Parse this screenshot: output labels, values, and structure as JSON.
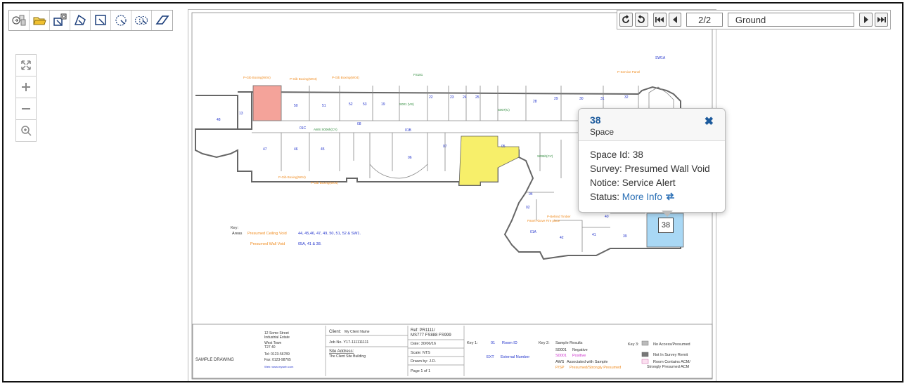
{
  "toolbar": {
    "tools": [
      {
        "name": "layers-icon"
      },
      {
        "name": "open-folder-icon"
      },
      {
        "name": "select-refresh-icon"
      },
      {
        "name": "polygon-select-icon"
      },
      {
        "name": "rectangle-select-icon"
      },
      {
        "name": "circle-select-icon"
      },
      {
        "name": "multi-circle-select-icon"
      },
      {
        "name": "eraser-icon"
      }
    ]
  },
  "zoom": {
    "items": [
      {
        "name": "fit-extent-icon"
      },
      {
        "name": "zoom-in-icon"
      },
      {
        "name": "zoom-out-icon"
      },
      {
        "name": "zoom-magnifier-icon"
      }
    ]
  },
  "nav": {
    "page": "2/2",
    "floor": "Ground"
  },
  "popup": {
    "title": "38",
    "subtitle": "Space",
    "close": "✖",
    "space_id_label": "Space Id:",
    "space_id": "38",
    "survey_label": "Survey:",
    "survey": "Presumed Wall Void",
    "notice_label": "Notice:",
    "notice": "Service Alert",
    "status_label": "Status:",
    "status_link": "More Info"
  },
  "marker": "38",
  "plan": {
    "rooms": [
      "48",
      "13",
      "50",
      "51",
      "52",
      "53",
      "19",
      "15",
      "20",
      "21",
      "22",
      "23",
      "24",
      "25",
      "26",
      "27",
      "28",
      "29",
      "30",
      "31",
      "32",
      "33",
      "34",
      "35",
      "36",
      "37",
      "38",
      "39",
      "40",
      "41",
      "42",
      "43",
      "44",
      "45",
      "46",
      "47",
      "01A",
      "01B",
      "01C",
      "02",
      "03",
      "04",
      "05",
      "06",
      "07",
      "08",
      "09",
      "10",
      "11",
      "12",
      "14",
      "16",
      "17",
      "18"
    ],
    "room_labels": {
      "r48": "48",
      "r13": "13",
      "r50": "50",
      "r51": "51",
      "r52": "52",
      "r53": "53",
      "r19": "19",
      "r22": "22",
      "r23": "23",
      "r24": "24",
      "r25": "25",
      "r28": "28",
      "r29": "29",
      "r30": "30",
      "r31": "31",
      "r32": "32",
      "r47": "47",
      "r46": "46",
      "r45": "45",
      "r08": "08",
      "r06": "06",
      "r07": "07",
      "r05": "05",
      "r04": "04",
      "r02": "02",
      "r01A": "01A",
      "r42": "42",
      "r41": "41",
      "r40": "40",
      "r39": "39",
      "r01C": "01C",
      "r01B": "01B",
      "rSW1": "SW1A"
    },
    "notes": {
      "pgb1": "P-Gib Boxing(W04)",
      "pgb2": "P-Gib Boxing(W04)",
      "pgb3": "P-Gib Boxing(W04)",
      "pgb4": "P-Gib Boxing(W04)",
      "pgb5": "P-Gib Boxing(W04)",
      "psp": "P-Service Panel",
      "fs1": "FS181",
      "fs2": "AWS S006h(CV)",
      "fs3": "S001 (VS)",
      "fs4": "S007(C)",
      "fs5": "S006h(CV)",
      "pbt": "P-Behind Timber",
      "fa": "Panel Above Fire place"
    },
    "key": {
      "title": "Key:",
      "areas_label": "Areas",
      "row1_name": "Presumed Ceiling Void",
      "row1_value": "44, 45,46, 47, 49, 50, 51, 52 & SW1.",
      "row2_name": "Presumed Wall Void",
      "row2_value": "05A, 41 & 38."
    },
    "title_block": {
      "sample": "SAMPLE DRAWING",
      "addr1": "12 Some Street",
      "addr2": "Industrial Estate",
      "addr3": "West Town",
      "addr4": "T27 40",
      "tel": "Tel: 0123-56789",
      "fax": "Fax: 0123-98765",
      "web": "Web: www.myweb.com",
      "client_label": "Client:",
      "client": "My Client Name",
      "job": "Job No. Y17-111111111",
      "site_label": "Site Address:",
      "site": "The Client Site Building",
      "ref": "Ref: PR1111/",
      "ref2": "MS777 FS888 FS999",
      "date": "Date: 30/06/16",
      "scale": "Scale: NTS",
      "drawn": "Drawn by: J.D.",
      "page": "Page 1 of 1",
      "key1": "Key 1:",
      "k1a_code": "01",
      "k1a": "Room ID",
      "k1b_code": "EXT",
      "k1b": "External Number",
      "key2": "Key 2:",
      "k2title": "Sample Results",
      "k2a_code": "S0001",
      "k2a": "Negative",
      "k2b_code": "S0001",
      "k2b": "Positive",
      "k2c_code": "AWS",
      "k2c": "Associated with Sample",
      "k2d_code": "P/SP",
      "k2d": "Presumed/Strongly Presumed",
      "key3": "Key 3:",
      "k3a": "No Access/Presumed",
      "k3b": "Not In Survey Remit",
      "k3c": "Room Contains ACM/",
      "k3c2": "Strongly Presumed ACM"
    }
  },
  "colors": {
    "accent": "#1c5a9c",
    "link": "#2a6fb5",
    "room_red": "#f4a39a",
    "room_yellow": "#f7ef6a",
    "room_blue": "#a9d8f5",
    "room_id": "#2233cc",
    "sample": "#2d8a3a",
    "presumed": "#f08c20"
  }
}
